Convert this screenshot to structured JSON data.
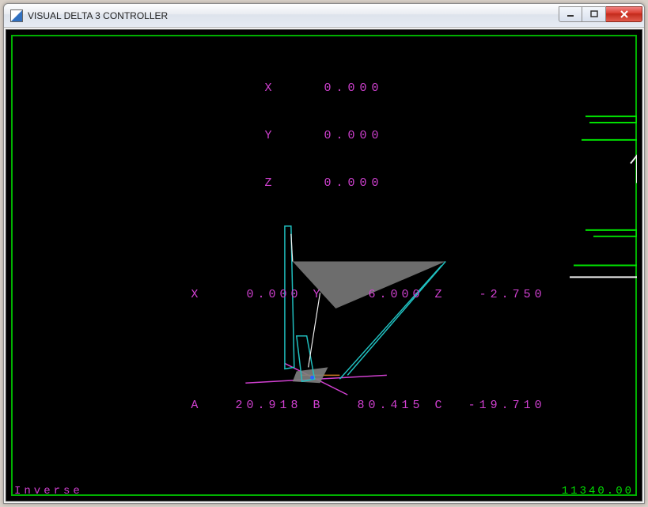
{
  "window": {
    "title": "VISUAL DELTA 3 CONTROLLER"
  },
  "top_readout": {
    "X_label": "X",
    "X_value": "0.000",
    "Y_label": "Y",
    "Y_value": "0.000",
    "Z_label": "Z",
    "Z_value": "0.000"
  },
  "bottom_row1": {
    "X_label": "X",
    "X_value": "0.000",
    "Y_label": "Y",
    "Y_value": "6.000",
    "Z_label": "Z",
    "Z_value": "-2.750"
  },
  "bottom_row2": {
    "A_label": "A",
    "A_value": "20.918",
    "B_label": "B",
    "B_value": "80.415",
    "C_label": "C",
    "C_value": "-19.710"
  },
  "status": {
    "mode": "Inverse",
    "counter": "11340.00"
  },
  "colors": {
    "accent": "#d040d0",
    "frame": "#00b000",
    "wire_cyan": "#20c0c0",
    "wire_white": "#f0f0f0",
    "fill_grey": "#808080"
  }
}
